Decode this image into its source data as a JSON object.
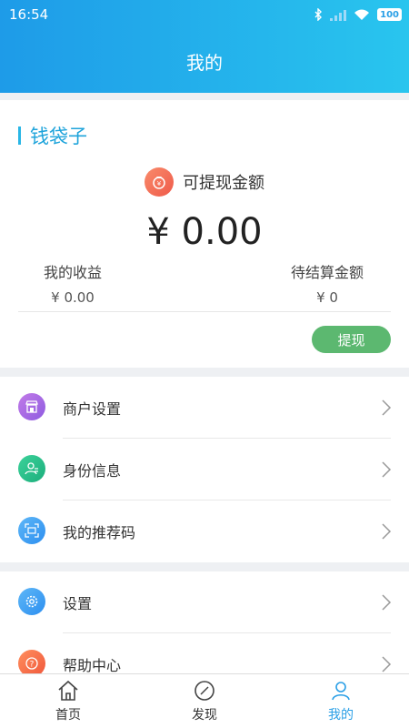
{
  "status_bar": {
    "time": "16:54",
    "battery": "100",
    "icons": [
      "bluetooth-icon",
      "signal-icon",
      "wifi-icon",
      "battery-icon"
    ]
  },
  "header": {
    "title": "我的"
  },
  "wallet": {
    "heading": "钱袋子",
    "withdrawable_label": "可提现金额",
    "amount": "¥ 0.00",
    "earnings_label": "我的收益",
    "earnings_value": "¥ 0.00",
    "pending_label": "待结算金额",
    "pending_value": "¥ 0",
    "withdraw_button": "提现"
  },
  "menu_group_1": [
    {
      "label": "商户设置",
      "icon": "store-icon"
    },
    {
      "label": "身份信息",
      "icon": "identity-icon"
    },
    {
      "label": "我的推荐码",
      "icon": "qr-code-icon"
    }
  ],
  "menu_group_2": [
    {
      "label": "设置",
      "icon": "gear-icon"
    },
    {
      "label": "帮助中心",
      "icon": "help-icon"
    }
  ],
  "tabs": [
    {
      "label": "首页",
      "icon": "home-icon",
      "active": false
    },
    {
      "label": "发现",
      "icon": "compass-icon",
      "active": false
    },
    {
      "label": "我的",
      "icon": "user-icon",
      "active": true
    }
  ],
  "colors": {
    "header_start": "#1e9be8",
    "header_end": "#29c5ee",
    "accent": "#1fa4db",
    "withdraw_button": "#5cb870"
  }
}
